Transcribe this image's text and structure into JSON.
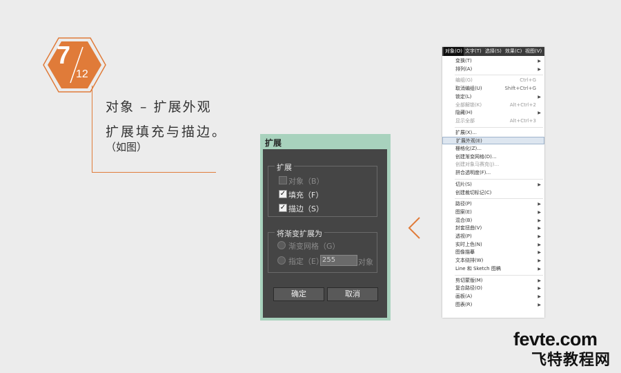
{
  "step": {
    "current": "7",
    "total": "12",
    "color": "#e07b39"
  },
  "heading": {
    "title": "对象 – 扩展外观",
    "description": "扩展填充与描边。",
    "note": "（如图）"
  },
  "dialog": {
    "title": "扩展",
    "group1": {
      "title": "扩展",
      "options": [
        {
          "label": "对象（B）",
          "checked": false,
          "disabled": true
        },
        {
          "label": "填充（F）",
          "checked": true,
          "disabled": false
        },
        {
          "label": "描边（S）",
          "checked": true,
          "disabled": false
        }
      ]
    },
    "group2": {
      "title": "将渐变扩展为",
      "option1": "渐变网格（G）",
      "option2": "指定（E）:",
      "value": "255",
      "unit": "对象"
    },
    "ok_label": "确定",
    "cancel_label": "取消"
  },
  "menu": {
    "bar": [
      {
        "label": "对象(O)",
        "active": true
      },
      {
        "label": "文字(T)",
        "active": false
      },
      {
        "label": "选择(S)",
        "active": false
      },
      {
        "label": "效果(C)",
        "active": false
      },
      {
        "label": "视图(V)",
        "active": false
      }
    ],
    "items": [
      {
        "label": "变换(T)",
        "shortcut": "",
        "submenu": true
      },
      {
        "label": "排列(A)",
        "shortcut": "",
        "submenu": true
      },
      {
        "sep": true
      },
      {
        "label": "编组(G)",
        "shortcut": "Ctrl+G",
        "submenu": false,
        "disabled": true
      },
      {
        "label": "取消编组(U)",
        "shortcut": "Shift+Ctrl+G",
        "submenu": false
      },
      {
        "label": "锁定(L)",
        "shortcut": "",
        "submenu": true
      },
      {
        "label": "全部解锁(K)",
        "shortcut": "Alt+Ctrl+2",
        "submenu": false,
        "disabled": true
      },
      {
        "label": "隐藏(H)",
        "shortcut": "",
        "submenu": true
      },
      {
        "label": "显示全部",
        "shortcut": "Alt+Ctrl+3",
        "submenu": false,
        "disabled": true
      },
      {
        "sep": true
      },
      {
        "label": "扩展(X)...",
        "shortcut": "",
        "submenu": false
      },
      {
        "label": "扩展外观(E)",
        "shortcut": "",
        "submenu": false,
        "highlighted": true
      },
      {
        "label": "栅格化(Z)...",
        "shortcut": "",
        "submenu": false
      },
      {
        "label": "创建渐变网格(D)...",
        "shortcut": "",
        "submenu": false
      },
      {
        "label": "创建对象马赛克(J)...",
        "shortcut": "",
        "submenu": false,
        "disabled": true
      },
      {
        "label": "拼合透明度(F)...",
        "shortcut": "",
        "submenu": false
      },
      {
        "sep": true
      },
      {
        "label": "切片(S)",
        "shortcut": "",
        "submenu": true
      },
      {
        "label": "创建裁切标记(C)",
        "shortcut": "",
        "submenu": false
      },
      {
        "sep": true
      },
      {
        "label": "路径(P)",
        "shortcut": "",
        "submenu": true
      },
      {
        "label": "图案(E)",
        "shortcut": "",
        "submenu": true
      },
      {
        "label": "混合(B)",
        "shortcut": "",
        "submenu": true
      },
      {
        "label": "封套扭曲(V)",
        "shortcut": "",
        "submenu": true
      },
      {
        "label": "透视(P)",
        "shortcut": "",
        "submenu": true
      },
      {
        "label": "实时上色(N)",
        "shortcut": "",
        "submenu": true
      },
      {
        "label": "图像描摹",
        "shortcut": "",
        "submenu": true
      },
      {
        "label": "文本绕排(W)",
        "shortcut": "",
        "submenu": true
      },
      {
        "label": "Line 和 Sketch 图稿",
        "shortcut": "",
        "submenu": true
      },
      {
        "sep": true
      },
      {
        "label": "剪切蒙版(M)",
        "shortcut": "",
        "submenu": true
      },
      {
        "label": "复合路径(O)",
        "shortcut": "",
        "submenu": true
      },
      {
        "label": "画板(A)",
        "shortcut": "",
        "submenu": true
      },
      {
        "label": "图表(R)",
        "shortcut": "",
        "submenu": true
      }
    ]
  },
  "watermark": {
    "line1": "fevte.com",
    "line2": "飞特教程网"
  }
}
